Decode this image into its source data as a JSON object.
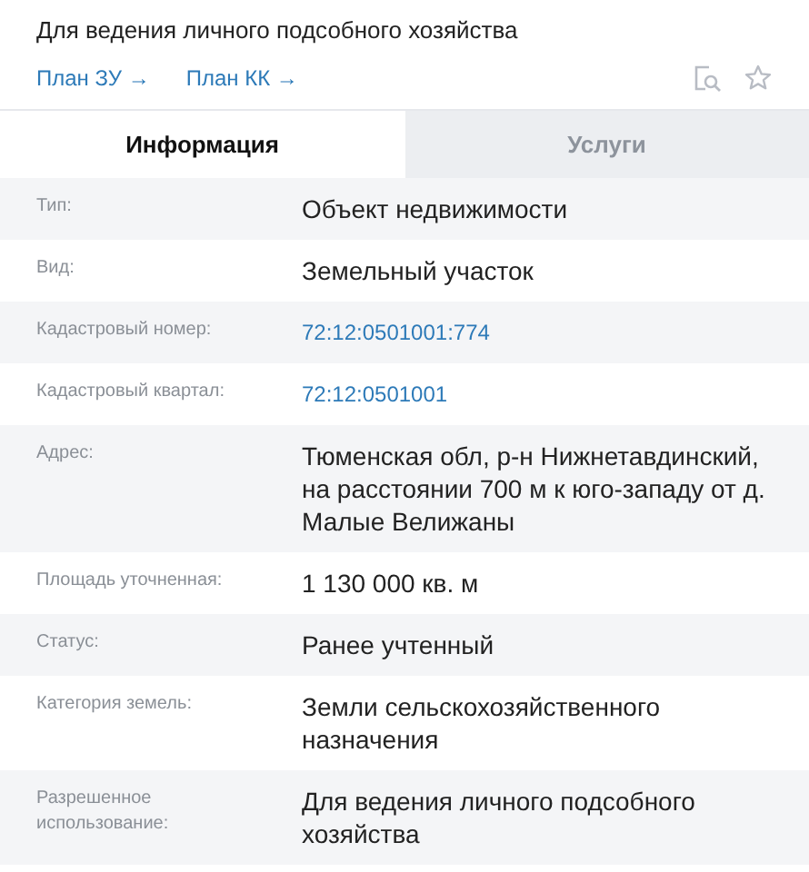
{
  "header": {
    "subtitle": "Для ведения личного подсобного хозяйства",
    "links": [
      {
        "label": "План ЗУ →"
      },
      {
        "label": "План КК →"
      }
    ]
  },
  "tabs": [
    {
      "label": "Информация",
      "selected": true
    },
    {
      "label": "Услуги",
      "selected": false
    }
  ],
  "rows": [
    {
      "label": "Тип:",
      "value": "Объект недвижимости",
      "kind": "text"
    },
    {
      "label": "Вид:",
      "value": "Земельный участок",
      "kind": "text"
    },
    {
      "label": "Кадастровый номер:",
      "value": "72:12:0501001:774",
      "kind": "link"
    },
    {
      "label": "Кадастровый квартал:",
      "value": "72:12:0501001",
      "kind": "link"
    },
    {
      "label": "Адрес:",
      "value": "Тюменская обл, р-н Нижнетавдинский, на расстоянии 700 м к юго-западу от д. Малые Велижаны",
      "kind": "text"
    },
    {
      "label": "Площадь уточненная:",
      "value": "1 130 000 кв. м",
      "kind": "text"
    },
    {
      "label": "Статус:",
      "value": "Ранее учтенный",
      "kind": "text"
    },
    {
      "label": "Категория земель:",
      "value": "Земли сельскохозяйственного назначения",
      "kind": "text"
    },
    {
      "label": "Разрешенное использование:",
      "value": "Для ведения личного подсобного хозяйства",
      "kind": "text"
    }
  ]
}
